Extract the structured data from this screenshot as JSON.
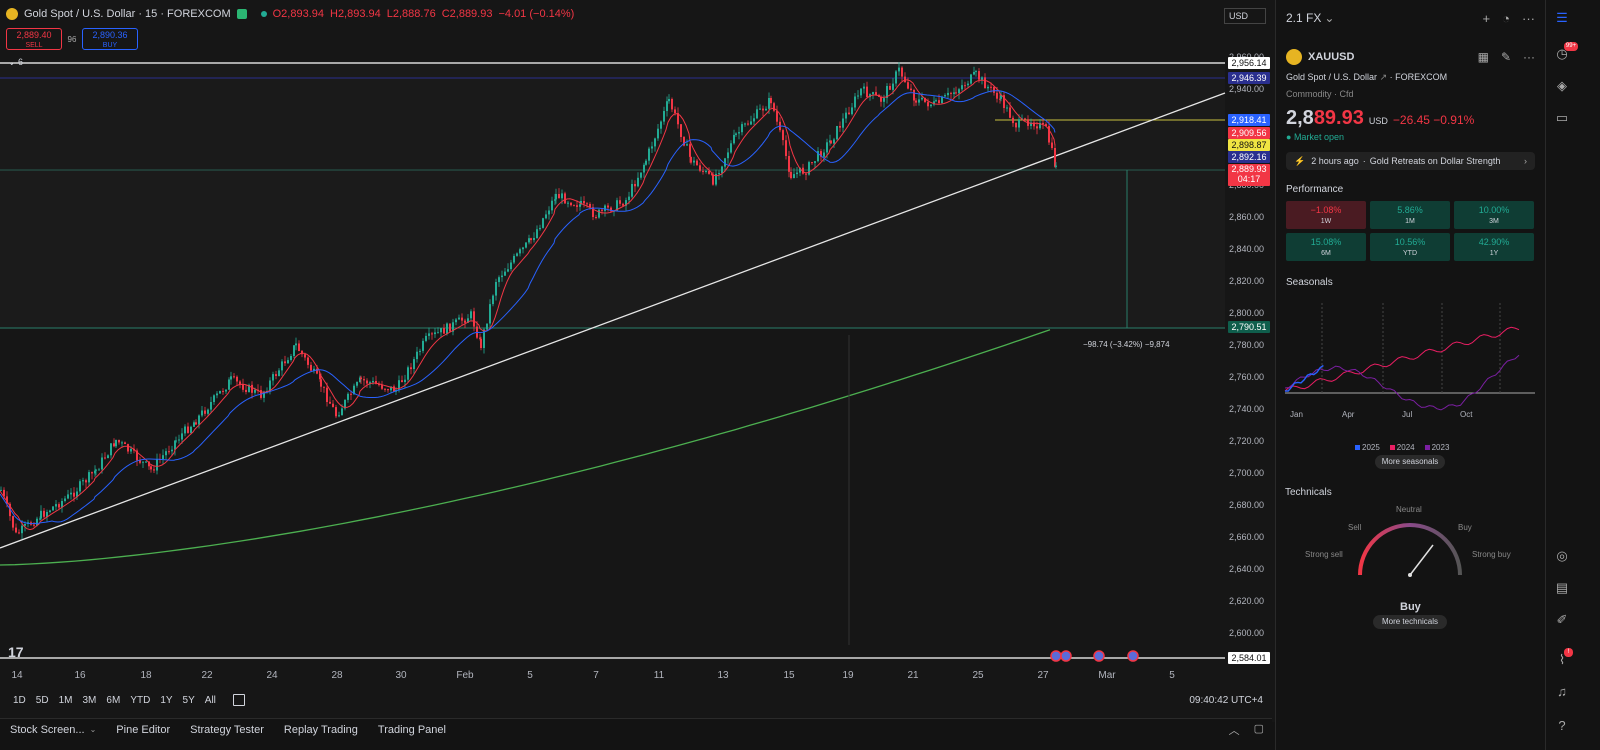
{
  "chart": {
    "symbol_title": "Gold Spot / U.S. Dollar · 15 · FOREXCOM",
    "open": "O2,893.94",
    "high": "H2,893.94",
    "low": "L2,888.76",
    "close": "C2,889.93",
    "change": "−4.01 (−0.14%)",
    "sell_price": "2,889.40",
    "sell_label": "SELL",
    "spread": "96",
    "buy_price": "2,890.36",
    "buy_label": "BUY",
    "currency": "USD",
    "hline_label": "6",
    "measure_label": "−98.74 (−3.42%) −9,874",
    "price_axis": [
      "2,960.00",
      "2,940.00",
      "2,920.00",
      "2,900.00",
      "2,880.00",
      "2,860.00",
      "2,840.00",
      "2,820.00",
      "2,800.00",
      "2,780.00",
      "2,760.00",
      "2,740.00",
      "2,720.00",
      "2,700.00",
      "2,680.00",
      "2,660.00",
      "2,640.00",
      "2,620.00",
      "2,600.00"
    ],
    "price_tags": {
      "t1": "2,956.14",
      "t2": "2,946.39",
      "t3": "2,918.41",
      "t4": "2,909.56",
      "t5": "2,898.87",
      "t6": "2,892.16",
      "t7": "2,889.93",
      "t7b": "04:17",
      "t8": "2,790.51",
      "t9": "2,584.01"
    },
    "x_axis": [
      "14",
      "16",
      "18",
      "22",
      "24",
      "28",
      "30",
      "Feb",
      "5",
      "7",
      "11",
      "13",
      "15",
      "19",
      "21",
      "25",
      "27",
      "Mar",
      "5"
    ],
    "colors": {
      "up": "#22ab94",
      "down": "#f23645",
      "ma_fast": "#f23645",
      "ma_slow": "#2962ff",
      "ma_long": "#4caf50"
    }
  },
  "toolbar": {
    "ranges": [
      "1D",
      "5D",
      "1M",
      "3M",
      "6M",
      "YTD",
      "1Y",
      "5Y",
      "All"
    ],
    "clock": "09:40:42 UTC+4"
  },
  "panel_tabs": [
    "Stock Screen...",
    "Pine Editor",
    "Strategy Tester",
    "Replay Trading",
    "Trading Panel"
  ],
  "watchlist": {
    "header": "2.1 FX",
    "symbol": "XAUUSD",
    "description": "Gold Spot / U.S. Dollar",
    "exchange": "FOREXCOM",
    "category": "Commodity · Cfd",
    "price_main": "2,8",
    "price_tail": "89.93",
    "currency": "USD",
    "change": "−26.45  −0.91%",
    "market_status": "Market open",
    "news_time": "2 hours ago",
    "news_headline": "Gold Retreats on Dollar Strength",
    "performance_title": "Performance",
    "performance": [
      {
        "value": "−1.08%",
        "label": "1W",
        "dir": "neg"
      },
      {
        "value": "5.86%",
        "label": "1M",
        "dir": "pos"
      },
      {
        "value": "10.00%",
        "label": "3M",
        "dir": "pos"
      },
      {
        "value": "15.08%",
        "label": "6M",
        "dir": "pos"
      },
      {
        "value": "10.56%",
        "label": "YTD",
        "dir": "pos"
      },
      {
        "value": "42.90%",
        "label": "1Y",
        "dir": "pos"
      }
    ],
    "seasonals_title": "Seasonals",
    "seasonals_months": [
      "Jan",
      "Apr",
      "Jul",
      "Oct"
    ],
    "seasonals_legend": [
      {
        "name": "2025",
        "color": "#2962ff"
      },
      {
        "name": "2024",
        "color": "#e91e63"
      },
      {
        "name": "2023",
        "color": "#7b1fa2"
      }
    ],
    "more_seasonals": "More seasonals",
    "technicals_title": "Technicals",
    "tech_labels": {
      "neutral": "Neutral",
      "sell": "Sell",
      "buy": "Buy",
      "strong_sell": "Strong sell",
      "strong_buy": "Strong buy"
    },
    "tech_result": "Buy",
    "more_technicals": "More technicals"
  },
  "rightbar": {
    "badge": "99+",
    "badge2": "!"
  }
}
